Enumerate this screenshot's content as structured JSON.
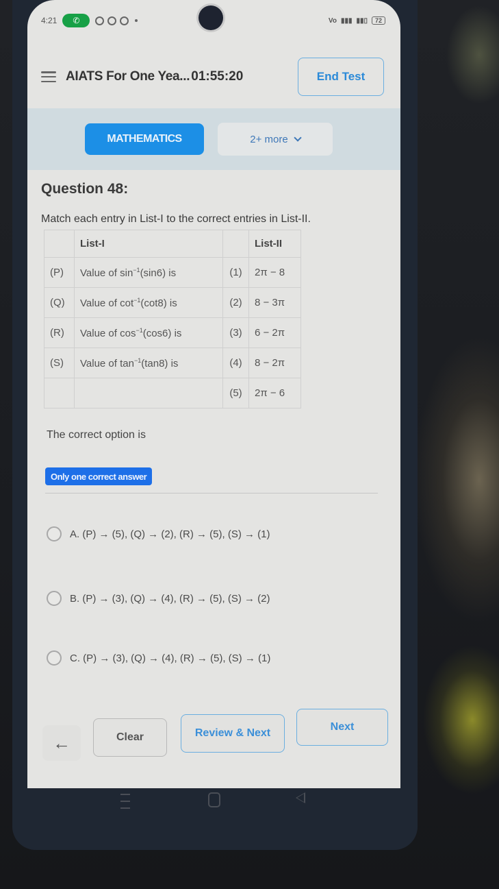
{
  "status_bar": {
    "time": "4:21",
    "battery": "72",
    "network_label": "Vo LTE"
  },
  "header": {
    "title": "AIATS For One Yea...",
    "timer": "01:55:20",
    "end_test_label": "End Test"
  },
  "subjects": {
    "active": "MATHEMATICS",
    "more_label": "2+ more"
  },
  "question": {
    "title": "Question 48:",
    "prompt": "Match each entry in List-I to the correct entries in List-II.",
    "table": {
      "headers": [
        "",
        "List-I",
        "",
        "List-II"
      ],
      "rows": [
        {
          "key": "(P)",
          "func": "sin",
          "arg": "(sin6)",
          "suffix": " is",
          "num": "(1)",
          "value": "2π − 8"
        },
        {
          "key": "(Q)",
          "func": "cot",
          "arg": "(cot8)",
          "suffix": " is",
          "num": "(2)",
          "value": "8 − 3π"
        },
        {
          "key": "(R)",
          "func": "cos",
          "arg": "(cos6)",
          "suffix": " is",
          "num": "(3)",
          "value": "6 − 2π"
        },
        {
          "key": "(S)",
          "func": "tan",
          "arg": "(tan8)",
          "suffix": " is",
          "num": "(4)",
          "value": "8 − 2π"
        },
        {
          "key": "",
          "func": "",
          "arg": "",
          "suffix": "",
          "num": "(5)",
          "value": "2π − 6"
        }
      ],
      "value_prefix": "Value of ",
      "inverse_sup": "−1"
    },
    "stem_end": "The correct option is",
    "answer_type": "Only one correct answer",
    "options": [
      {
        "label": "A. (P) → (5), (Q) → (2), (R) → (5), (S) → (1)",
        "selected": false
      },
      {
        "label": "B. (P) → (3), (Q) → (4), (R) → (5), (S) → (2)",
        "selected": false
      },
      {
        "label": "C. (P) → (3), (Q) → (4), (R) → (5), (S) → (1)",
        "selected": false
      }
    ]
  },
  "footer": {
    "back_icon": "←",
    "clear_label": "Clear",
    "review_next_label": "Review & Next",
    "next_label": "Next"
  },
  "colors": {
    "accent": "#1c8fe6",
    "badge": "#1d6fe8",
    "call_pill": "#17a046"
  }
}
